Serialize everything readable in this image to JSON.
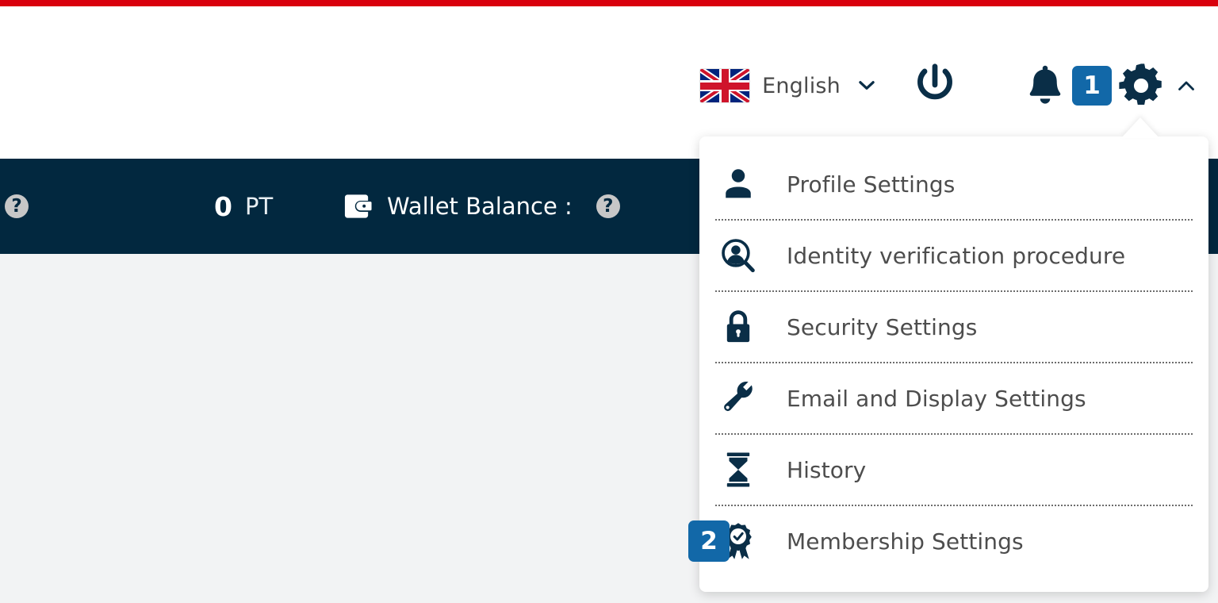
{
  "theme": {
    "accent_red": "#d9000d",
    "navy": "#02283f",
    "badge_blue": "#1268a8",
    "page_bg": "#f2f3f4",
    "menu_text": "#4d4d4d"
  },
  "header": {
    "language": {
      "icon": "uk-flag-icon",
      "label": "English",
      "chevron": "chevron-down-icon"
    },
    "power": {
      "icon": "power-icon"
    },
    "notifications": {
      "icon": "bell-icon",
      "badge": "1"
    },
    "settings": {
      "icon": "gear-icon",
      "toggle_icon": "chevron-up-icon"
    }
  },
  "infobar": {
    "help_icon_left": "?",
    "points_value": "0",
    "points_unit": "PT",
    "wallet_icon": "wallet-icon",
    "wallet_label": "Wallet Balance :",
    "help_icon_right": "?"
  },
  "settings_menu": {
    "items": [
      {
        "icon": "person-icon",
        "label": "Profile Settings",
        "badge": ""
      },
      {
        "icon": "id-verify-icon",
        "label": "Identity verification procedure",
        "badge": ""
      },
      {
        "icon": "lock-icon",
        "label": "Security Settings",
        "badge": ""
      },
      {
        "icon": "wrench-icon",
        "label": "Email and Display Settings",
        "badge": ""
      },
      {
        "icon": "hourglass-icon",
        "label": "History",
        "badge": ""
      },
      {
        "icon": "award-ribbon-icon",
        "label": "Membership Settings",
        "badge": "2"
      }
    ]
  }
}
